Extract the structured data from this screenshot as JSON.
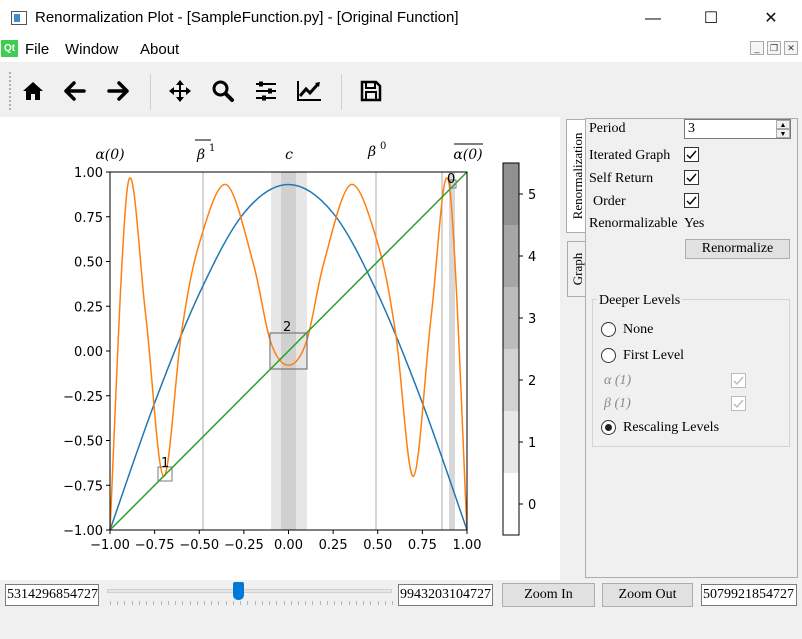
{
  "window": {
    "title": "Renormalization Plot - [SampleFunction.py] - [Original Function]",
    "minimize": "—",
    "maximize": "☐",
    "close": "✕"
  },
  "menu": {
    "qt_badge": "Qt",
    "file": "File",
    "window": "Window",
    "about": "About"
  },
  "toolbar": [
    "home-icon",
    "back-icon",
    "forward-icon",
    "pan-icon",
    "zoom-icon",
    "configure-subplots-icon",
    "edit-axis-icon",
    "save-icon"
  ],
  "plot": {
    "top_labels": [
      "α(0)",
      "β",
      "1",
      "c",
      "β",
      "0",
      "α(0)"
    ],
    "x_ticks": [
      "−1.00",
      "−0.75",
      "−0.50",
      "−0.25",
      "0.00",
      "0.25",
      "0.50",
      "0.75",
      "1.00"
    ],
    "y_ticks": [
      "1.00",
      "0.75",
      "0.50",
      "0.25",
      "0.00",
      "−0.25",
      "−0.50",
      "−0.75",
      "−1.00"
    ],
    "colorbar_ticks": [
      "5",
      "4",
      "3",
      "2",
      "1",
      "0"
    ],
    "box_labels": [
      "0",
      "1",
      "2"
    ],
    "colors": {
      "quadratic": "#1f77b4",
      "iterated": "#ff7f0e",
      "diagonal": "#2ca02c"
    }
  },
  "chart_data": {
    "type": "line",
    "xlim": [
      -1,
      1
    ],
    "ylim": [
      -1,
      1
    ],
    "series": [
      {
        "color": "#1f77b4",
        "x": [
          -1,
          -0.75,
          -0.5,
          -0.25,
          0,
          0.25,
          0.5,
          0.75,
          1
        ],
        "y": [
          -1,
          -0.29,
          0.32,
          0.77,
          0.93,
          0.77,
          0.32,
          -0.29,
          -1
        ]
      },
      {
        "color": "#ff7f0e",
        "x": [
          -1,
          -0.9,
          -0.8,
          -0.7,
          -0.6,
          -0.5,
          -0.35,
          -0.2,
          -0.1,
          0,
          0.1,
          0.2,
          0.35,
          0.5,
          0.6,
          0.7,
          0.8,
          0.9,
          1
        ],
        "y": [
          -1,
          0.93,
          0.2,
          -0.7,
          0.1,
          0.6,
          0.93,
          0.5,
          0.05,
          -0.08,
          0.05,
          0.5,
          0.93,
          0.6,
          0.1,
          -0.7,
          0.2,
          0.93,
          -1
        ]
      },
      {
        "color": "#2ca02c",
        "x": [
          -1,
          1
        ],
        "y": [
          -1,
          1
        ]
      }
    ],
    "colorbar": {
      "range": [
        -0.5,
        5.5
      ],
      "ticks": [
        0,
        1,
        2,
        3,
        4,
        5
      ]
    }
  },
  "panel": {
    "tab_renorm": "Renormalization",
    "tab_graph": "Graph",
    "period_label": "Period",
    "period_value": "3",
    "iterated_graph": "Iterated Graph",
    "self_return": "Self Return",
    "order": "Order",
    "renormalizable": "Renormalizable",
    "renormalizable_value": "Yes",
    "renormalize_button": "Renormalize",
    "deeper_levels": "Deeper Levels",
    "none": "None",
    "first_level": "First Level",
    "alpha1": "α (1)",
    "beta1": "β (1)",
    "rescaling": "Rescaling Levels",
    "check": "✓"
  },
  "bottom": {
    "left_value": "5314296854727",
    "middle_value": "9943203104727",
    "right_value": "5079921854727",
    "zoom_in": "Zoom In",
    "zoom_out": "Zoom Out",
    "slider_level": 0.46
  }
}
